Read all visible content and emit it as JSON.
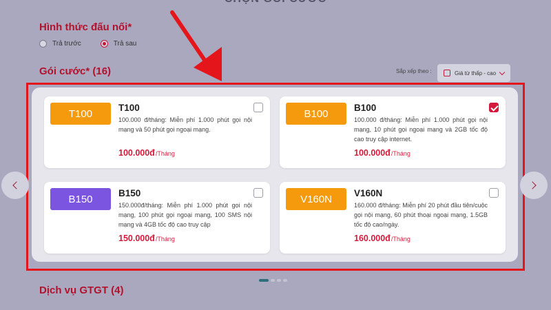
{
  "page": {
    "heading": "CHỌN GÓI CƯỚC"
  },
  "connection": {
    "title": "Hình thức đấu nối*",
    "options": [
      {
        "label": "Trả trước",
        "selected": false
      },
      {
        "label": "Trả sau",
        "selected": true
      }
    ]
  },
  "packages": {
    "title": "Gói cước* (16)",
    "sort_label": "Sắp xếp theo :",
    "sort_value": "Giá từ thấp - cao",
    "items": [
      {
        "badge": "T100",
        "badge_color": "#f59a0c",
        "name": "T100",
        "description": "100.000 đ/tháng: Miễn phí 1.000 phút gọi nội mạng và 50 phút gọi ngoại mạng.",
        "price": "100.000đ",
        "unit": "/Tháng",
        "checked": false
      },
      {
        "badge": "B100",
        "badge_color": "#f59a0c",
        "name": "B100",
        "description": "100.000 đ/tháng: Miễn phí 1.000 phút gọi nội mạng, 10 phút gọi ngoại mạng và 2GB tốc độ cao truy cập internet.",
        "price": "100.000đ",
        "unit": "/Tháng",
        "checked": true
      },
      {
        "badge": "B150",
        "badge_color": "#7b55e0",
        "name": "B150",
        "description": "150.000đ/tháng: Miễn phí 1.000 phút gọi nội mạng, 100 phút gọi ngoại mạng, 100 SMS nội mạng và 4GB tốc độ cao truy cập",
        "price": "150.000đ",
        "unit": "/Tháng",
        "checked": false
      },
      {
        "badge": "V160N",
        "badge_color": "#f59a0c",
        "name": "V160N",
        "description": "160.000 đ/tháng: Miễn phí 20 phút đầu tiên/cuộc gọi nội mạng, 60 phút thoại ngoại mạng, 1.5GB tốc độ cao/ngày.",
        "price": "160.000đ",
        "unit": "/Tháng",
        "checked": false
      }
    ],
    "pagination": {
      "pages": 4,
      "active": 1
    }
  },
  "vas": {
    "title": "Dịch vụ GTGT (4)"
  },
  "icons": {
    "prev": "chevron-left-icon",
    "next": "chevron-right-icon",
    "sort": "calendar-icon",
    "dropdown": "chevron-down-icon"
  },
  "colors": {
    "accent": "#b3122d",
    "price": "#d41a3c",
    "highlight": "#e5161b",
    "arrow": "#e5161b"
  }
}
